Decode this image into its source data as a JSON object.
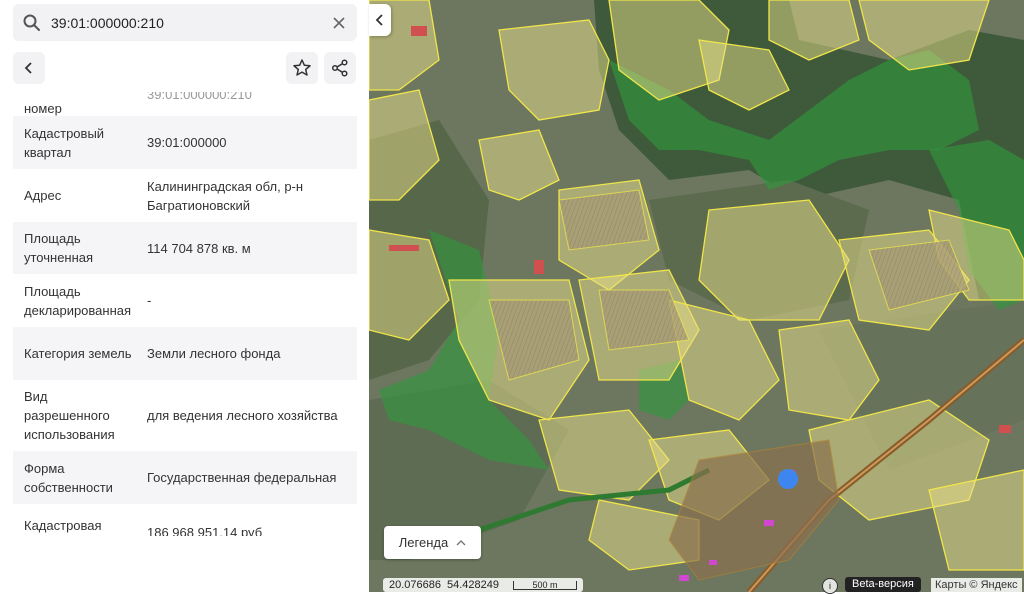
{
  "search": {
    "value": "39:01:000000:210"
  },
  "partial_row": {
    "value": "39:01:000000:210",
    "label": "номер"
  },
  "rows": [
    {
      "label": "Кадастровый квартал",
      "value": "39:01:000000"
    },
    {
      "label": "Адрес",
      "value": "Калининградская обл, р-н Багратионовский"
    },
    {
      "label": "Площадь уточненная",
      "value": "114 704 878 кв. м"
    },
    {
      "label": "Площадь декларированная",
      "value": "-"
    },
    {
      "label": "Категория земель",
      "value": "Земли лесного фонда"
    },
    {
      "label": "Вид разрешенного использования",
      "value": "для ведения лесного хозяйства"
    },
    {
      "label": "Форма собственности",
      "value": "Государственная федеральная"
    },
    {
      "label": "Кадастровая",
      "value": "186 968 951,14 руб"
    }
  ],
  "map": {
    "legend_label": "Легенда",
    "coord_x": "20.076686",
    "coord_y": "54.428249",
    "scale_label": "500 m",
    "beta_label": "Beta-версия",
    "copyright": "Карты © Яндекс",
    "colors": {
      "parcel_fill": "#e8e089",
      "parcel_stroke": "#f0e54a",
      "forest_fill": "#2e9a3c",
      "marker": "#3d86f0"
    }
  }
}
